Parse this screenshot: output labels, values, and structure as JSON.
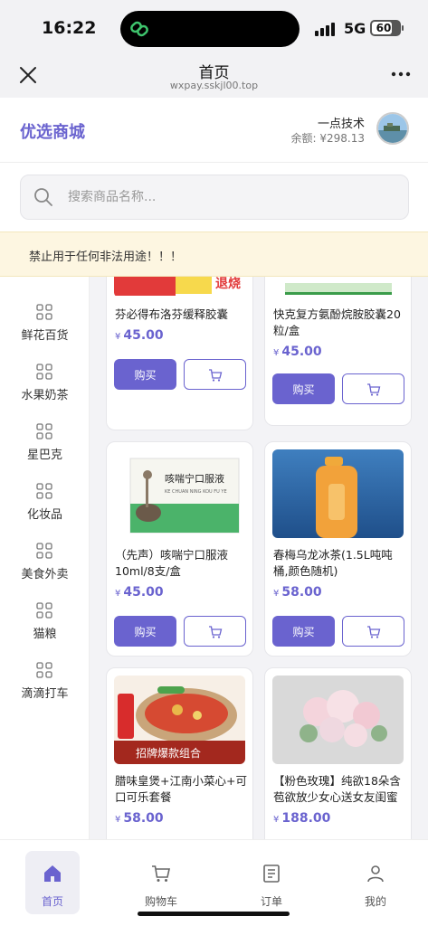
{
  "status_bar": {
    "time": "16:22",
    "network": "5G",
    "battery": "60"
  },
  "browser": {
    "title": "首页",
    "url": "wxpay.sskjl00.top"
  },
  "store": {
    "name": "优选商城",
    "user_name": "一点技术",
    "balance": "余额: ¥298.13"
  },
  "search": {
    "placeholder": "搜索商品名称..."
  },
  "notice": {
    "text": "禁止用于任何非法用途！！！"
  },
  "sidebar": {
    "items": [
      {
        "label": "鲜花百货"
      },
      {
        "label": "水果奶茶"
      },
      {
        "label": "星巴克"
      },
      {
        "label": "化妆品"
      },
      {
        "label": "美食外卖"
      },
      {
        "label": "猫粮"
      },
      {
        "label": "滴滴打车"
      }
    ]
  },
  "products": {
    "currency": "¥",
    "buy_label": "购买",
    "items": [
      {
        "name": "芬必得布洛芬缓释胶囊",
        "price": "45.00",
        "image_text": "退烧"
      },
      {
        "name": "快克复方氨酚烷胺胶囊20粒/盒",
        "price": "45.00"
      },
      {
        "name": "（先声）咳喘宁口服液10ml/8支/盒",
        "price": "45.00",
        "image_text": "咳喘宁口服液",
        "image_subtext": "KE CHUAN NING KOU FU YE"
      },
      {
        "name": "春梅乌龙冰茶(1.5L吨吨桶,颜色随机)",
        "price": "58.00"
      },
      {
        "name": "腊味皇煲+江南小菜心+可口可乐套餐",
        "price": "58.00",
        "image_text": "招牌爆款组合"
      },
      {
        "name": "【粉色玫瑰】纯欲18朵含苞欲放少女心送女友闺蜜",
        "price": "188.00"
      }
    ]
  },
  "tabbar": {
    "tabs": [
      {
        "label": "首页"
      },
      {
        "label": "购物车"
      },
      {
        "label": "订单"
      },
      {
        "label": "我的"
      }
    ]
  },
  "colors": {
    "accent": "#6a63cf",
    "notice_bg": "#fdf6e1"
  }
}
